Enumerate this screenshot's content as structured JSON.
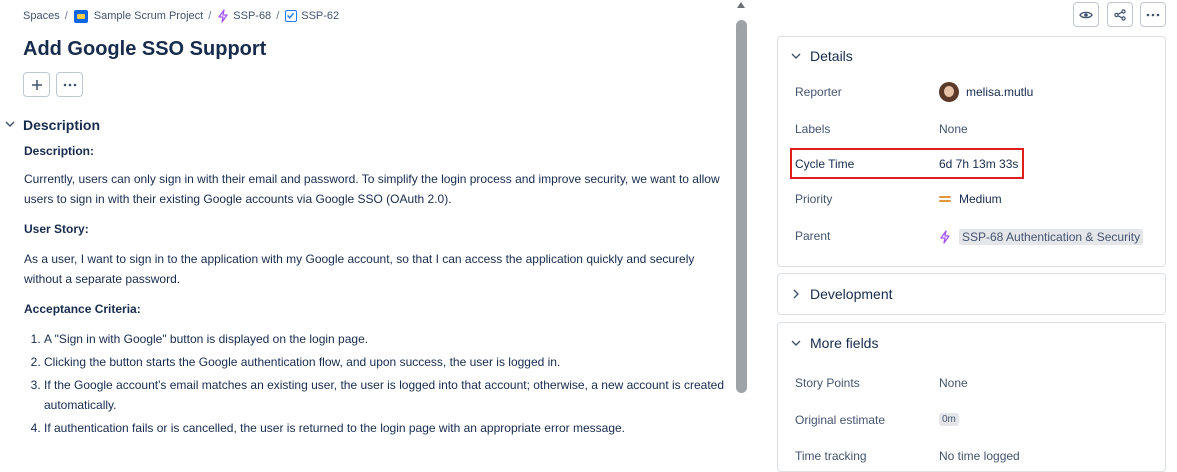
{
  "breadcrumb": {
    "spaces": "Spaces",
    "project": "Sample Scrum Project",
    "epic": "SSP-68",
    "issue": "SSP-62",
    "separator": "/"
  },
  "issue": {
    "title": "Add Google SSO Support",
    "add_icon": "plus-icon",
    "more_icon": "more-horizontal-icon"
  },
  "description": {
    "heading": "Description",
    "sub_description": "Description:",
    "intro": "Currently, users can only sign in with their email and password. To simplify the login process and improve security, we want to allow users to sign in with their existing Google accounts via Google SSO (OAuth 2.0).",
    "user_story_heading": "User Story:",
    "user_story": "As a user, I want to sign in to the application with my Google account, so that I can access the application quickly and securely without a separate password.",
    "acceptance_heading": "Acceptance Criteria:",
    "criteria": [
      "A \"Sign in with Google\" button is displayed on the login page.",
      "Clicking the button starts the Google authentication flow, and upon success, the user is logged in.",
      "If the Google account's email matches an existing user, the user is logged into that account; otherwise, a new account is created automatically.",
      "If authentication fails or is cancelled, the user is returned to the login page with an appropriate error message."
    ]
  },
  "header_actions": {
    "watch_icon": "eye-icon",
    "share_icon": "share-icon",
    "more_icon": "more-horizontal-icon"
  },
  "details": {
    "heading": "Details",
    "reporter_label": "Reporter",
    "reporter_value": "melisa.mutlu",
    "labels_label": "Labels",
    "labels_value": "None",
    "cycle_label": "Cycle Time",
    "cycle_value": "6d 7h 13m 33s",
    "priority_label": "Priority",
    "priority_value": "Medium",
    "parent_label": "Parent",
    "parent_value": "SSP-68 Authentication & Security"
  },
  "development": {
    "heading": "Development"
  },
  "more_fields": {
    "heading": "More fields",
    "story_points_label": "Story Points",
    "story_points_value": "None",
    "original_estimate_label": "Original estimate",
    "original_estimate_value": "0m",
    "time_tracking_label": "Time tracking",
    "time_tracking_value": "No time logged"
  },
  "colors": {
    "accent": "#0c66e4",
    "highlight": "#e01e1e",
    "priority_medium": "#e2973f",
    "epic_purple": "#a855f7"
  }
}
